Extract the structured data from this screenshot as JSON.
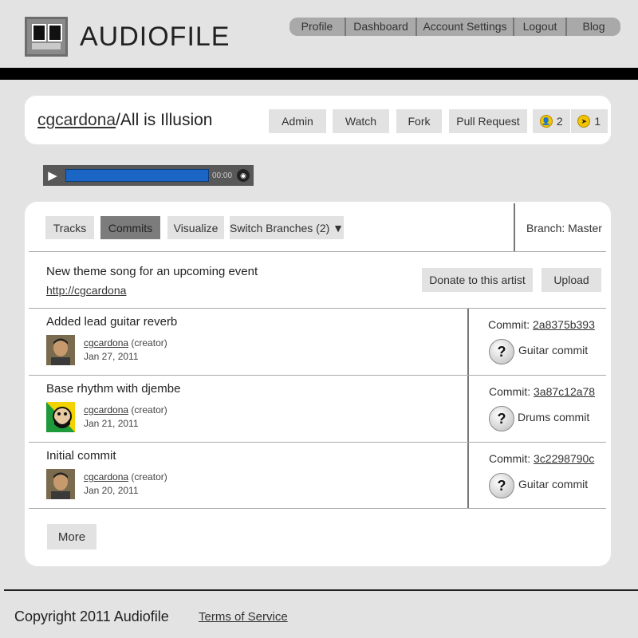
{
  "brand": {
    "name": "AUDIOFILE"
  },
  "topnav": [
    "Profile",
    "Dashboard",
    "Account Settings",
    "Logout",
    "Blog"
  ],
  "repo": {
    "owner": "cgcardona",
    "separator": "/",
    "name": "All is Illusion",
    "buttons": [
      "Admin",
      "Watch",
      "Fork",
      "Pull Request"
    ],
    "watchers": "2",
    "forks": "1"
  },
  "player": {
    "time": "00:00",
    "progress": 0.0
  },
  "tabs": [
    "Tracks",
    "Commits",
    "Visualize",
    "Switch Branches (2) ▼"
  ],
  "branch": "Branch: Master",
  "description": {
    "text": "New theme song for an upcoming event",
    "link": "http://cgcardona"
  },
  "actions": {
    "donate": "Donate to this artist",
    "upload": "Upload"
  },
  "commits": [
    {
      "title": "Added lead guitar reverb",
      "author": "cgcardona",
      "role": "(creator)",
      "date": "Jan 27, 2011",
      "commit_label": "Commit:",
      "hash": "2a8375b393",
      "kind": "Guitar commit"
    },
    {
      "title": "Base rhythm with djembe",
      "author": "cgcardona",
      "role": "(creator)",
      "date": "Jan 21, 2011",
      "commit_label": "Commit:",
      "hash": "3a87c12a78",
      "kind": "Drums commit"
    },
    {
      "title": "Initial commit",
      "author": "cgcardona",
      "role": "(creator)",
      "date": "Jan 20, 2011",
      "commit_label": "Commit:",
      "hash": "3c2298790c",
      "kind": "Guitar commit"
    }
  ],
  "more": "More",
  "footer": {
    "copyright": "Copyright 2011 Audiofile",
    "terms": "Terms of Service"
  }
}
